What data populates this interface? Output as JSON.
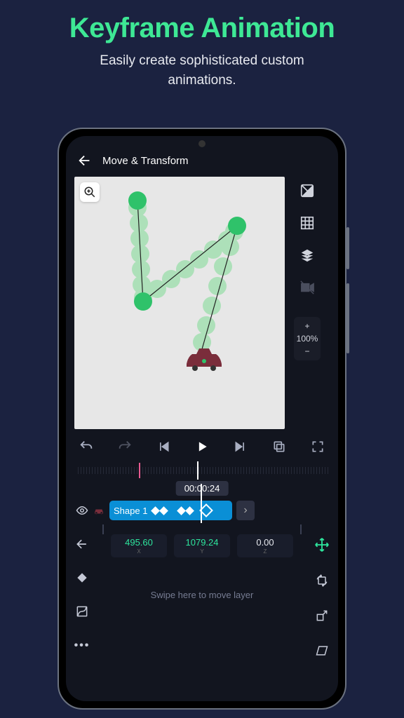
{
  "promo": {
    "title": "Keyframe Animation",
    "subtitle_l1": "Easily create sophisticated custom",
    "subtitle_l2": "animations."
  },
  "header": {
    "title": "Move & Transform"
  },
  "zoom": {
    "plus": "+",
    "value": "100%",
    "minus": "−"
  },
  "timeline": {
    "current_time": "00:00:24",
    "clip_label": "Shape 1"
  },
  "coords": {
    "x": {
      "value": "495.60",
      "label": "X"
    },
    "y": {
      "value": "1079.24",
      "label": "Y"
    },
    "z": {
      "value": "0.00",
      "label": "Z"
    }
  },
  "hint": "Swipe here to move layer"
}
